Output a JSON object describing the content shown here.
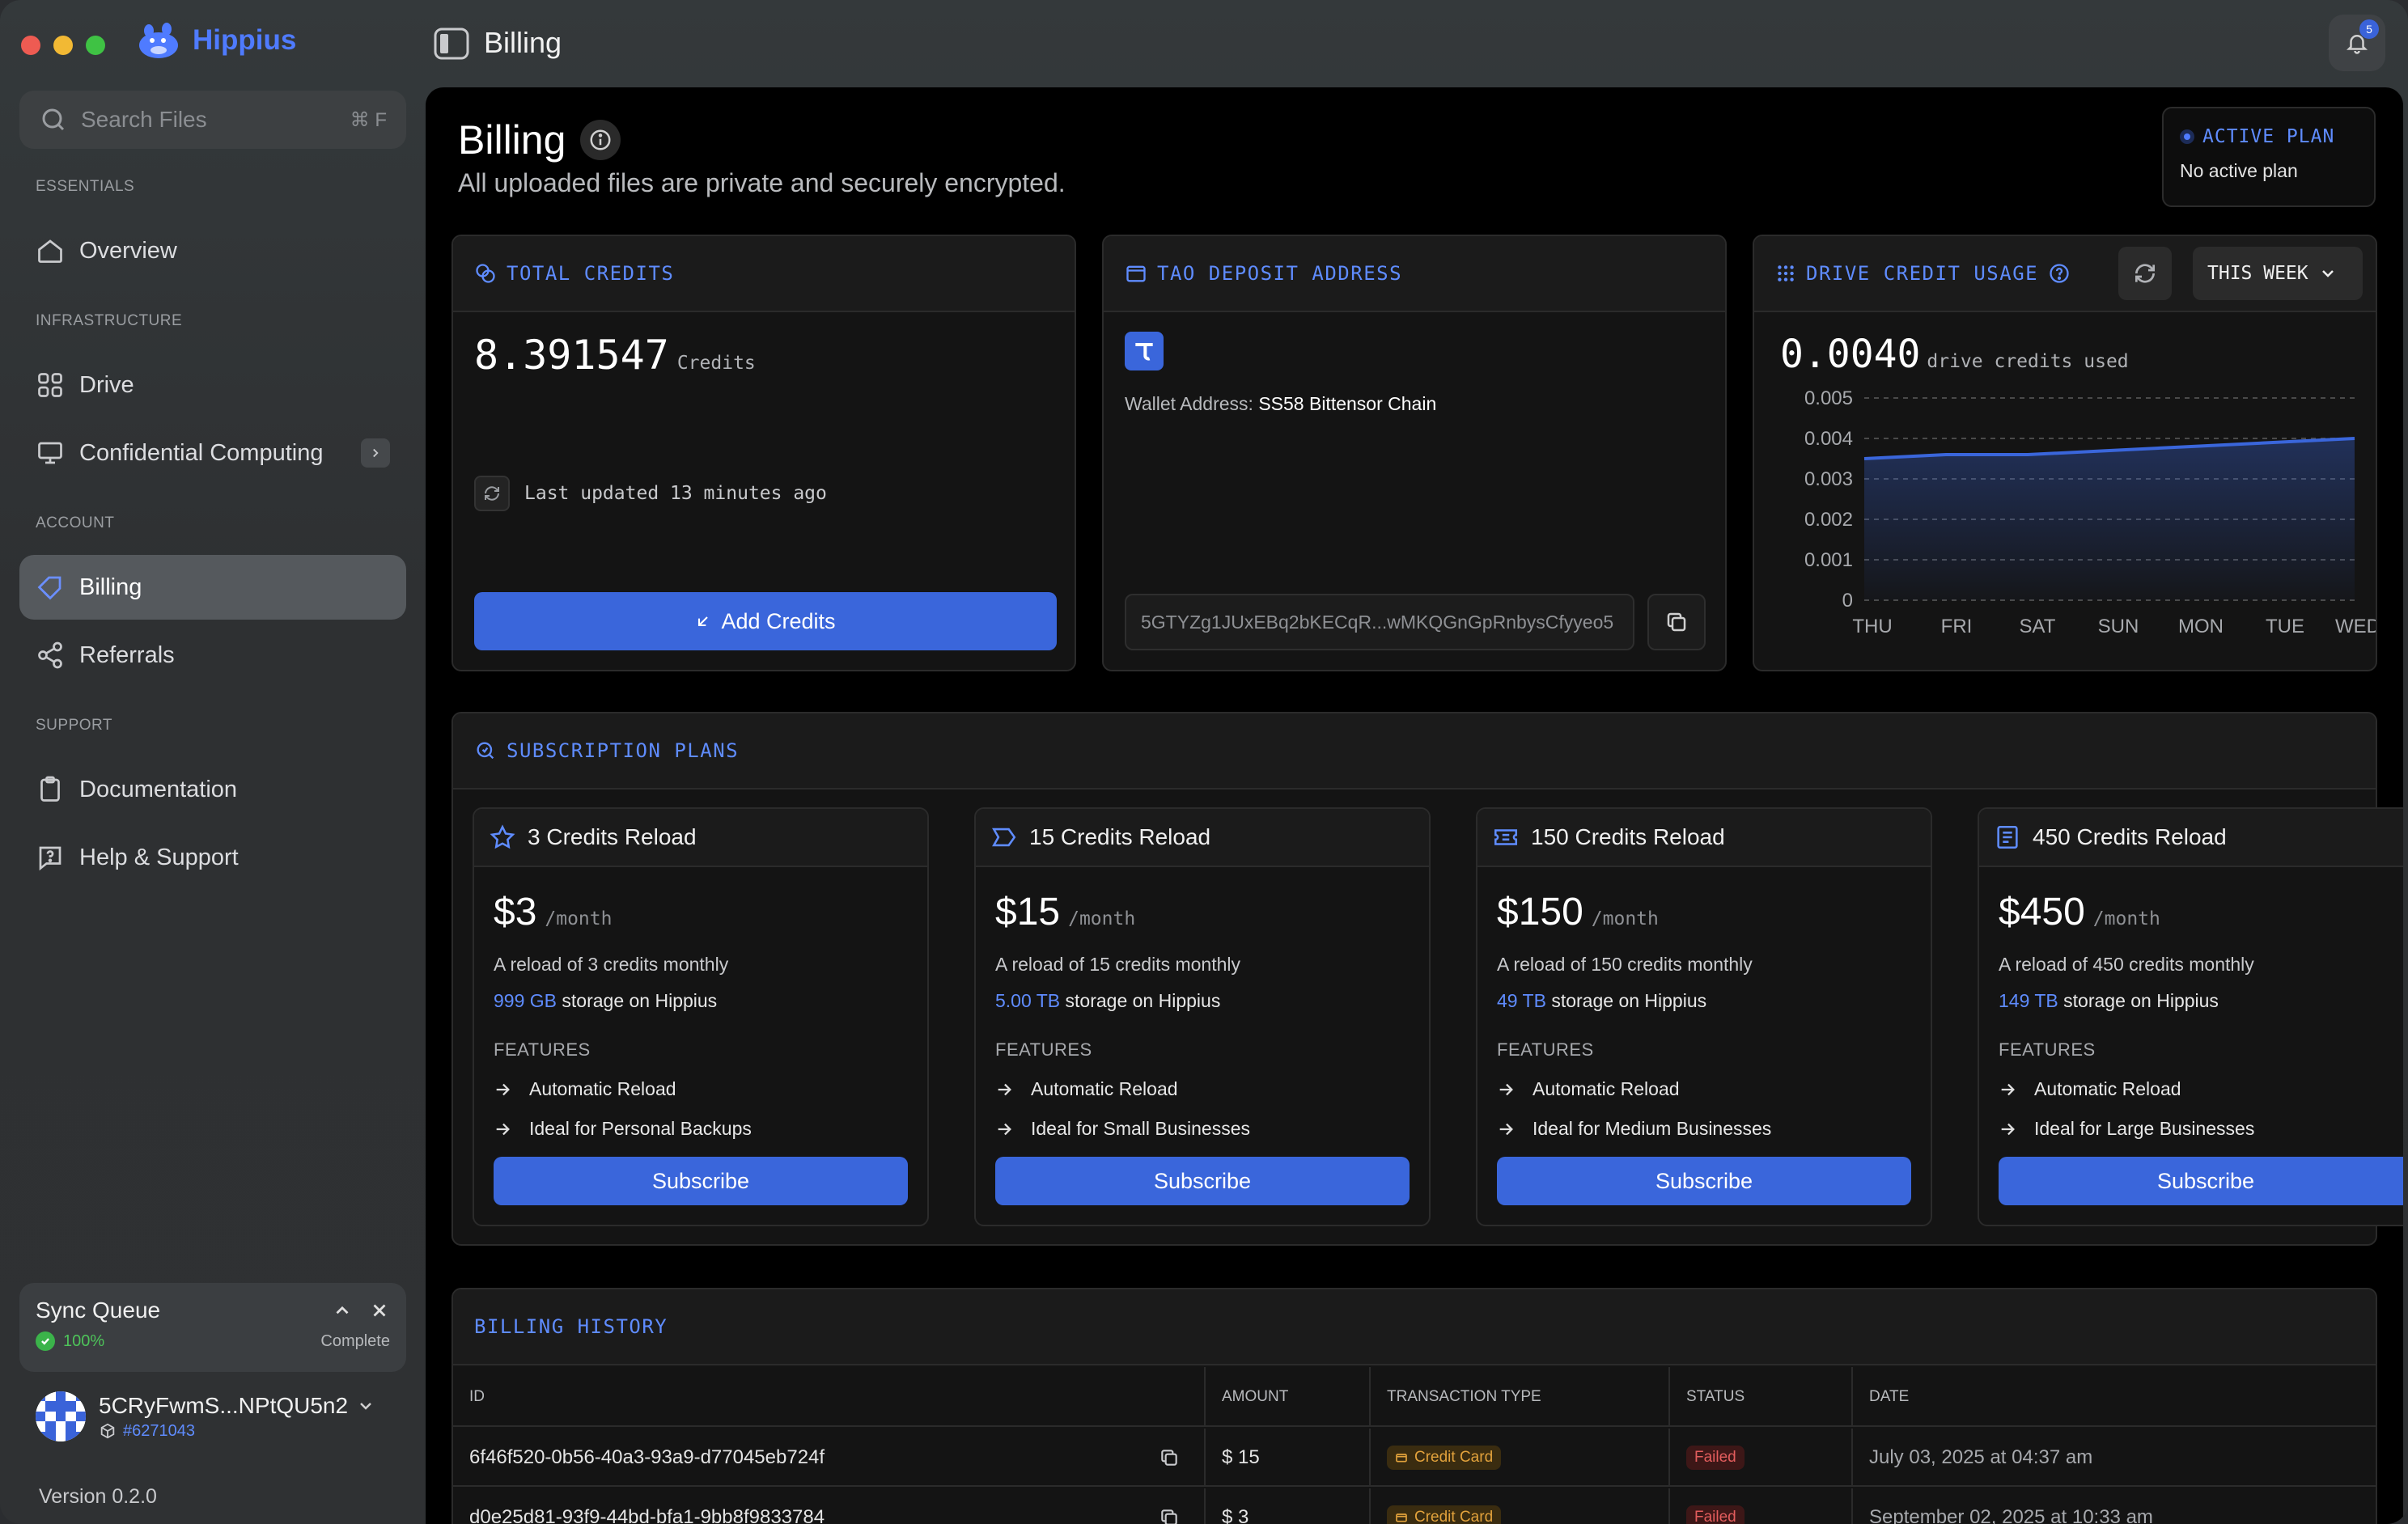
{
  "app": {
    "name": "Hippius",
    "window_title": "Billing",
    "notification_count": "5"
  },
  "search": {
    "placeholder": "Search Files",
    "shortcut": "⌘ F"
  },
  "sidebar": {
    "sections": {
      "essentials": "ESSENTIALS",
      "infrastructure": "INFRASTRUCTURE",
      "account": "ACCOUNT",
      "support": "SUPPORT"
    },
    "items": [
      {
        "label": "Overview",
        "icon": "home-icon"
      },
      {
        "label": "Drive",
        "icon": "grid-icon"
      },
      {
        "label": "Confidential Computing",
        "icon": "monitor-icon"
      },
      {
        "label": "Billing",
        "icon": "tag-icon",
        "active": true
      },
      {
        "label": "Referrals",
        "icon": "share-icon"
      },
      {
        "label": "Documentation",
        "icon": "clipboard-icon"
      },
      {
        "label": "Help & Support",
        "icon": "help-icon"
      }
    ],
    "sync_queue": {
      "title": "Sync Queue",
      "percent": "100%",
      "status": "Complete"
    },
    "account": {
      "name": "5CRyFwmS...NPtQU5n2",
      "block": "#6271043"
    },
    "version": "Version 0.2.0"
  },
  "page": {
    "title": "Billing",
    "subtitle": "All uploaded files are private and securely encrypted.",
    "active_plan": {
      "label": "ACTIVE PLAN",
      "value": "No active plan"
    }
  },
  "credits_card": {
    "title": "TOTAL CREDITS",
    "amount": "8.391547",
    "unit": "Credits",
    "last_updated": "Last updated 13 minutes ago",
    "button": "Add Credits"
  },
  "deposit_card": {
    "title": "TAO DEPOSIT ADDRESS",
    "wallet_label": "Wallet Address:",
    "wallet_chain": "SS58 Bittensor Chain",
    "address": "5GTYZg1JUxEBq2bKECqR...wMKQGnGpRnbysCfyyeo5"
  },
  "usage_card": {
    "title": "DRIVE CREDIT USAGE",
    "range": "THIS WEEK",
    "amount": "0.0040",
    "unit": "drive credits used"
  },
  "chart_data": {
    "type": "area",
    "title": "",
    "xlabel": "",
    "ylabel": "",
    "categories": [
      "THU",
      "FRI",
      "SAT",
      "SUN",
      "MON",
      "TUE",
      "WED"
    ],
    "values": [
      0.0035,
      0.0036,
      0.0036,
      0.0037,
      0.0038,
      0.0039,
      0.004
    ],
    "ylim": [
      0,
      0.005
    ],
    "yticks": [
      "0.005",
      "0.004",
      "0.003",
      "0.002",
      "0.001",
      "0"
    ],
    "grid": true,
    "color": "#3a66db"
  },
  "subscriptions": {
    "title": "SUBSCRIPTION PLANS",
    "features_label": "FEATURES",
    "per": "/month",
    "button": "Subscribe",
    "storage_suffix": "storage on Hippius",
    "plans": [
      {
        "name": "3 Credits Reload",
        "icon": "star-icon",
        "price": "$3",
        "desc": "A reload of 3 credits monthly",
        "storage": "999 GB",
        "features": [
          "Automatic Reload",
          "Ideal for Personal Backups"
        ]
      },
      {
        "name": "15 Credits Reload",
        "icon": "tag-outline-icon",
        "price": "$15",
        "desc": "A reload of 15 credits monthly",
        "storage": "5.00 TB",
        "features": [
          "Automatic Reload",
          "Ideal for Small Businesses"
        ]
      },
      {
        "name": "150 Credits Reload",
        "icon": "ticket-icon",
        "price": "$150",
        "desc": "A reload of 150 credits monthly",
        "storage": "49 TB",
        "features": [
          "Automatic Reload",
          "Ideal for Medium Businesses"
        ]
      },
      {
        "name": "450 Credits Reload",
        "icon": "receipt-icon",
        "price": "$450",
        "desc": "A reload of 450 credits monthly",
        "storage": "149 TB",
        "features": [
          "Automatic Reload",
          "Ideal for Large Businesses"
        ]
      }
    ]
  },
  "billing_history": {
    "title": "BILLING HISTORY",
    "columns": [
      "ID",
      "AMOUNT",
      "TRANSACTION TYPE",
      "STATUS",
      "DATE"
    ],
    "rows": [
      {
        "id": "6f46f520-0b56-40a3-93a9-d77045eb724f",
        "amount": "$ 15",
        "type": "Credit Card",
        "status": "Failed",
        "date": "July 03, 2025 at 04:37 am"
      },
      {
        "id": "d0e25d81-93f9-44bd-bfa1-9bb8f9833784",
        "amount": "$ 3",
        "type": "Credit Card",
        "status": "Failed",
        "date": "September 02, 2025 at 10:33 am"
      }
    ]
  }
}
